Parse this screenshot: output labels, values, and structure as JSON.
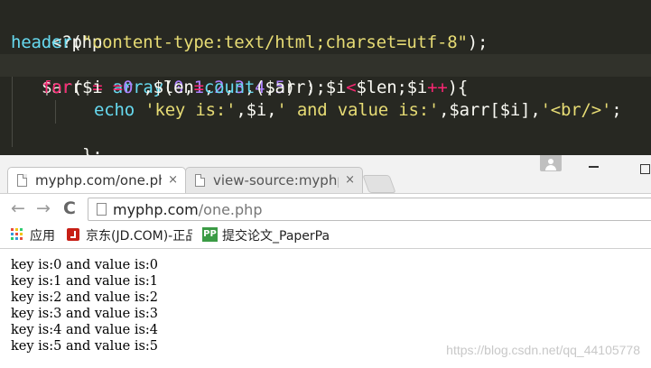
{
  "editor": {
    "line1": "<?php",
    "line2": {
      "fn": "header",
      "open": "(",
      "str": "\"content-type:text/html;charset=utf-8\"",
      "close": ");"
    },
    "line3": {
      "var": "$arr",
      "eq": " = ",
      "fn": "array",
      "open": "(",
      "nums": [
        "0",
        "1",
        "2",
        "3",
        "4",
        "5"
      ],
      "close": ") ;"
    },
    "line4": {
      "kw": "for",
      "p1": "($i ",
      "eq": "=",
      "n0": "0",
      "p2": " ,$len",
      "eq2": "=",
      "fn": "count",
      "p3": "($arr);$i",
      "lt": "<",
      "p4": "$len;$i",
      "inc": "++",
      "p5": "){"
    },
    "line5": {
      "fn": "echo",
      "s1": "'key is:'",
      "c1": ",$i,",
      "s2": "' and value is:'",
      "c2": ",$arr[$i],",
      "s3": "'<br/>'",
      "end": ";"
    },
    "line6": "};"
  },
  "browser": {
    "tabs": [
      {
        "label": "myphp.com/one.php",
        "close": "×"
      },
      {
        "label": "view-source:myphp.com/one.php",
        "close": "×"
      }
    ],
    "nav": {
      "back": "←",
      "forward": "→",
      "reload": "C"
    },
    "address": {
      "host": "myphp.com",
      "path": "/one.php"
    },
    "bookmarks": [
      {
        "label": "应用"
      },
      {
        "label": "京东(JD.COM)-正品低价"
      },
      {
        "label": "提交论文_PaperPass"
      }
    ],
    "pp_icon_text": "PP",
    "output": [
      "key is:0 and value is:0",
      "key is:1 and value is:1",
      "key is:2 and value is:2",
      "key is:3 and value is:3",
      "key is:4 and value is:4",
      "key is:5 and value is:5"
    ],
    "watermark": "https://blog.csdn.net/qq_44105778"
  },
  "colors": {
    "editor_bg": "#272822",
    "keyword": "#f92672",
    "function": "#66d9ef",
    "string": "#e6db74",
    "number": "#ae81ff"
  }
}
